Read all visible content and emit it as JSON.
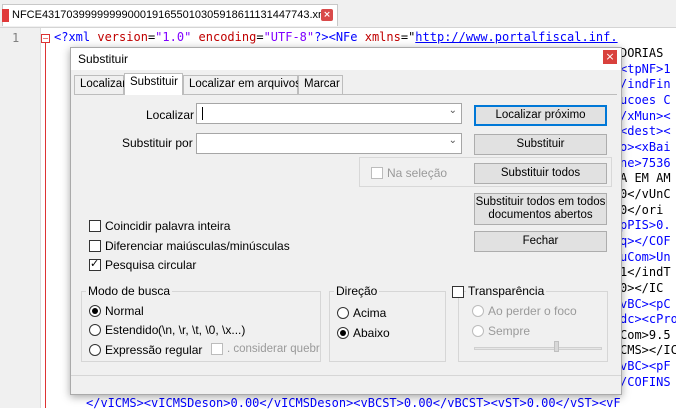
{
  "editor": {
    "tab_filename": "NFCE43170399999999000191655010305918611131447743.xml",
    "line_number": "1",
    "line1": {
      "p1": "<?xml ",
      "p2": "version",
      "p3": "=",
      "p4": "\"1.0\"",
      "p5": " ",
      "p6": "encoding",
      "p7": "=",
      "p8": "\"UTF-8\"",
      "p9": "?>",
      "p10": "<NFe ",
      "p11": "xmlns",
      "p12": "=\"",
      "p13": "http://www.portalfiscal.inf."
    },
    "right_column": [
      "DORIAS",
      "<tpNF>1",
      "/indFin",
      "ucoes C",
      "/xMun><",
      "<dest><",
      "o><xBai",
      "ne>7536",
      "A EM AM",
      "0</vUnC",
      "0</ori",
      "pPIS>0.",
      "q></COF",
      "uCom>Un",
      "1</indT",
      "0></IC",
      "vBC><pC",
      "dc><cPro",
      "Com>9.5",
      "CMS></IC",
      "vBC><pF",
      "/COFINS"
    ],
    "bottom_line": "</vICMS><vICMSDeson>0.00</vICMSDeson><vBCST>0.00</vBCST><vST>0.00</vST><vF"
  },
  "dialog": {
    "title": "Substituir",
    "close_label": "×",
    "tabs": [
      "Localizar",
      "Substituir",
      "Localizar em arquivos",
      "Marcar"
    ],
    "find_label": "Localizar :",
    "find_value": "",
    "replace_label": "Substituir por :",
    "replace_value": "",
    "buttons": {
      "find_next": "Localizar próximo",
      "replace": "Substituir",
      "replace_all": "Substituir todos",
      "replace_all_open_line1": "Substituir todos em todos",
      "replace_all_open_line2": "documentos abertos",
      "close": "Fechar"
    },
    "in_selection": {
      "label": "Na seleção",
      "checked": false,
      "disabled": true
    },
    "options": {
      "whole_word": {
        "label": "Coincidir palavra inteira",
        "checked": false
      },
      "match_case": {
        "label": "Diferenciar maiúsculas/minúsculas",
        "checked": false
      },
      "wrap_around": {
        "label": "Pesquisa circular",
        "checked": true
      }
    },
    "search_mode": {
      "title": "Modo de busca",
      "normal": "Normal",
      "extended": "Estendido",
      "extended_hint": "(\\n, \\r, \\t, \\0, \\x...)",
      "regex": "Expressão regular",
      "dot_newline": ". considerar quebr",
      "selected": "Normal"
    },
    "direction": {
      "title": "Direção",
      "up": "Acima",
      "down": "Abaixo",
      "selected": "Abaixo"
    },
    "transparency": {
      "title": "Transparência",
      "checked": false,
      "on_losing_focus": "Ao perder o foco",
      "always": "Sempre",
      "level": 0.65
    }
  }
}
